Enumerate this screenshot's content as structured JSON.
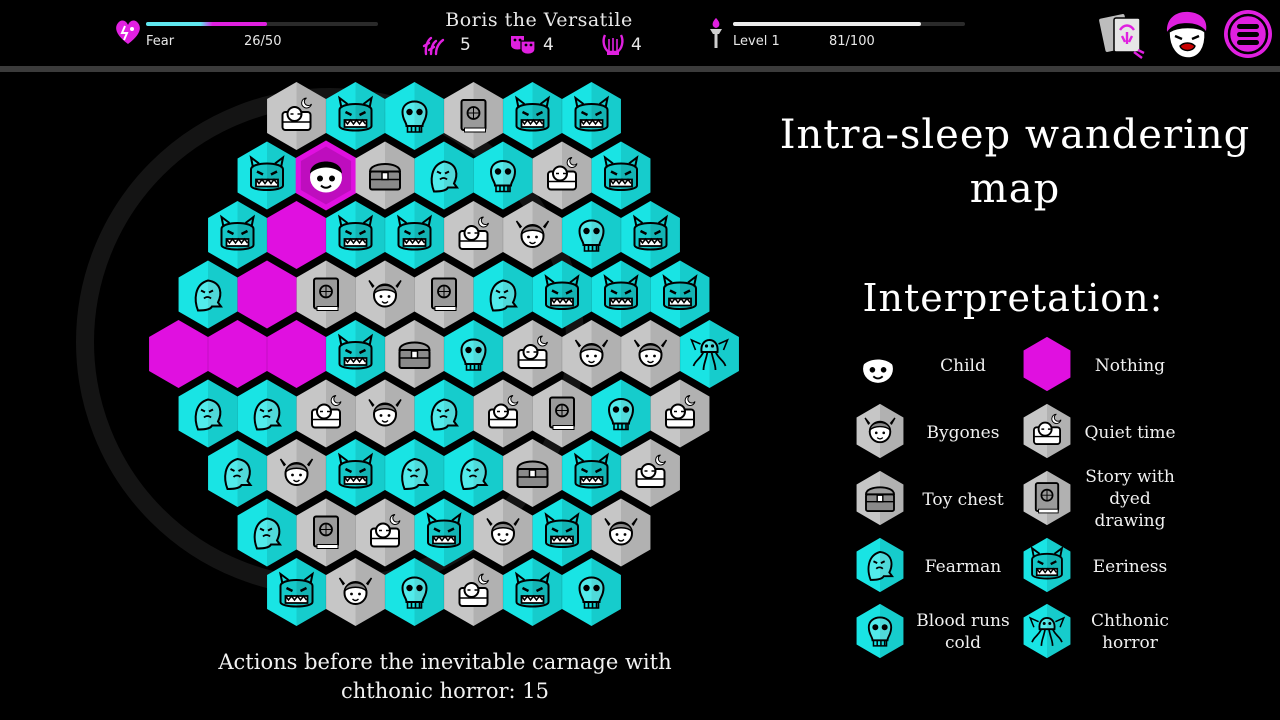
{
  "hud": {
    "fear": {
      "label": "Fear",
      "value_text": "26/50",
      "current": 26,
      "max": 50
    },
    "character_name": "Boris the Versatile",
    "counters": [
      {
        "icon": "hands-icon",
        "value": "5"
      },
      {
        "icon": "masks-icon",
        "value": "4"
      },
      {
        "icon": "lyre-icon",
        "value": "4"
      }
    ],
    "level": {
      "label": "Level 1",
      "value_text": "81/100",
      "current": 81,
      "max": 100
    },
    "buttons": [
      "cards-icon",
      "character-portrait-icon",
      "menu-icon"
    ]
  },
  "colors": {
    "cyan": "#19e4e4",
    "magenta": "#e010e0",
    "grey": "#c6c6c6",
    "hud_cyan": "#5fe8f0",
    "hud_magenta": "#e020e0"
  },
  "map": {
    "rows": [
      [
        "quiet-time",
        "eeriness",
        "blood-runs-cold",
        "story",
        "eeriness",
        "eeriness"
      ],
      [
        "eeriness",
        "child",
        "toy-chest",
        "fearman",
        "blood-runs-cold",
        "quiet-time",
        "eeriness"
      ],
      [
        "eeriness",
        "nothing",
        "eeriness",
        "eeriness",
        "quiet-time",
        "bygones",
        "blood-runs-cold",
        "eeriness"
      ],
      [
        "fearman",
        "nothing",
        "story",
        "bygones",
        "story",
        "fearman",
        "eeriness",
        "eeriness",
        "eeriness"
      ],
      [
        "nothing",
        "nothing",
        "nothing",
        "eeriness",
        "toy-chest",
        "blood-runs-cold",
        "quiet-time",
        "bygones",
        "bygones",
        "chthonic-horror"
      ],
      [
        "fearman",
        "fearman",
        "quiet-time",
        "bygones",
        "fearman",
        "quiet-time",
        "story",
        "blood-runs-cold",
        "quiet-time"
      ],
      [
        "fearman",
        "bygones",
        "eeriness",
        "fearman",
        "fearman",
        "toy-chest",
        "eeriness",
        "quiet-time"
      ],
      [
        "fearman",
        "story",
        "quiet-time",
        "eeriness",
        "bygones",
        "eeriness",
        "bygones"
      ],
      [
        "eeriness",
        "bygones",
        "blood-runs-cold",
        "quiet-time",
        "eeriness",
        "blood-runs-cold"
      ]
    ]
  },
  "caption": {
    "line1": "Actions before the inevitable carnage with",
    "line2": "chthonic horror: 15"
  },
  "panel": {
    "title_line1": "Intra-sleep wandering",
    "title_line2": "map",
    "legend_heading": "Interpretation:",
    "legend": [
      {
        "type": "child",
        "label": "Child"
      },
      {
        "type": "nothing",
        "label": "Nothing"
      },
      {
        "type": "bygones",
        "label": "Bygones"
      },
      {
        "type": "quiet-time",
        "label": "Quiet time"
      },
      {
        "type": "toy-chest",
        "label": "Toy chest"
      },
      {
        "type": "story",
        "label": "Story with dyed drawing"
      },
      {
        "type": "fearman",
        "label": "Fearman"
      },
      {
        "type": "eeriness",
        "label": "Eeriness"
      },
      {
        "type": "blood-runs-cold",
        "label": "Blood runs cold"
      },
      {
        "type": "chthonic-horror",
        "label": "Chthonic horror"
      }
    ]
  }
}
